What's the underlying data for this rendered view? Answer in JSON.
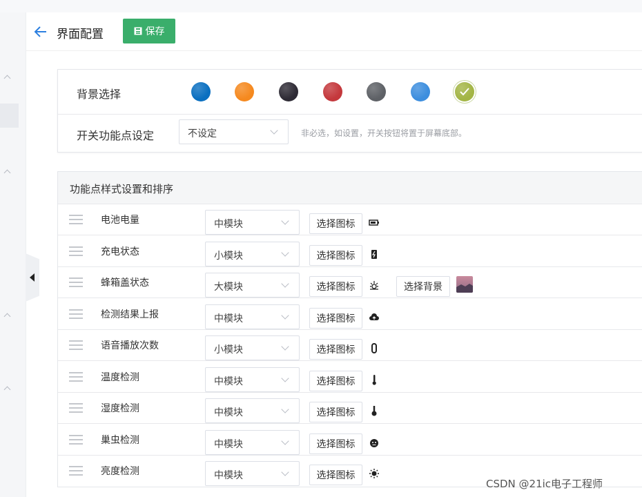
{
  "header": {
    "title": "界面配置",
    "save_label": "保存"
  },
  "config": {
    "bg_label": "背景选择",
    "swatches": [
      {
        "name": "blue",
        "color": "#0a6fc0"
      },
      {
        "name": "orange",
        "color": "#f5891f"
      },
      {
        "name": "dark",
        "color": "#2e2b35"
      },
      {
        "name": "red",
        "color": "#c4383c"
      },
      {
        "name": "gray",
        "color": "#5e6166"
      },
      {
        "name": "light-blue",
        "color": "#3d8ede"
      },
      {
        "name": "olive",
        "color": "#a3b545",
        "selected": true
      }
    ],
    "switch_label": "开关功能点设定",
    "switch_value": "不设定",
    "switch_hint": "非必选，如设置，开关按钮将置于屏幕底部。"
  },
  "features": {
    "title": "功能点样式设置和排序",
    "icon_button": "选择图标",
    "bg_button": "选择背景",
    "rows": [
      {
        "label": "电池电量",
        "size": "中模块",
        "icon": "battery-icon"
      },
      {
        "label": "充电状态",
        "size": "小模块",
        "icon": "charging-icon"
      },
      {
        "label": "蜂箱盖状态",
        "size": "大模块",
        "icon": "hive-icon",
        "has_bg": true
      },
      {
        "label": "检测结果上报",
        "size": "中模块",
        "icon": "cloud-upload-icon"
      },
      {
        "label": "语音播放次数",
        "size": "小模块",
        "icon": "counter-icon"
      },
      {
        "label": "温度检测",
        "size": "中模块",
        "icon": "thermometer-icon"
      },
      {
        "label": "湿度检测",
        "size": "中模块",
        "icon": "humidity-icon"
      },
      {
        "label": "巢虫检测",
        "size": "中模块",
        "icon": "bug-face-icon"
      },
      {
        "label": "亮度检测",
        "size": "中模块",
        "icon": "sun-icon"
      }
    ]
  },
  "watermark": "CSDN @21ic电子工程师"
}
